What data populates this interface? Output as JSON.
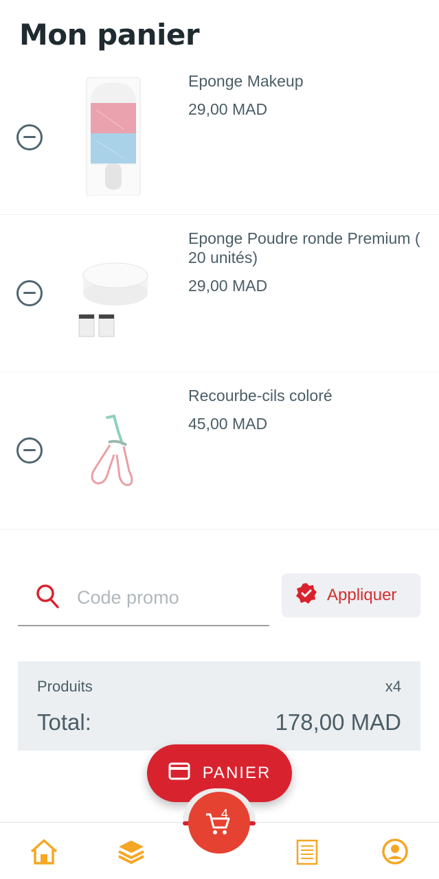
{
  "page": {
    "title": "Mon panier"
  },
  "items": [
    {
      "name": "Eponge Makeup",
      "price": "29,00 MAD"
    },
    {
      "name": "Eponge Poudre ronde Premium ( 20 unités)",
      "price": "29,00 MAD"
    },
    {
      "name": "Recourbe-cils coloré",
      "price": "45,00 MAD"
    }
  ],
  "promo": {
    "placeholder": "Code promo",
    "apply_label": "Appliquer"
  },
  "summary": {
    "products_label": "Produits",
    "products_count": "x4",
    "total_label": "Total:",
    "total_value": "178,00 MAD"
  },
  "cart_button": {
    "label": "PANIER"
  },
  "nav": {
    "cart_badge": "4"
  },
  "colors": {
    "accent": "#d8232f",
    "nav_icon": "#f5a623",
    "text": "#4b5d66"
  },
  "icons": [
    "remove-icon",
    "search-icon",
    "verified-badge-icon",
    "credit-card-icon",
    "home-icon",
    "layers-icon",
    "cart-icon",
    "orders-icon",
    "account-icon"
  ]
}
